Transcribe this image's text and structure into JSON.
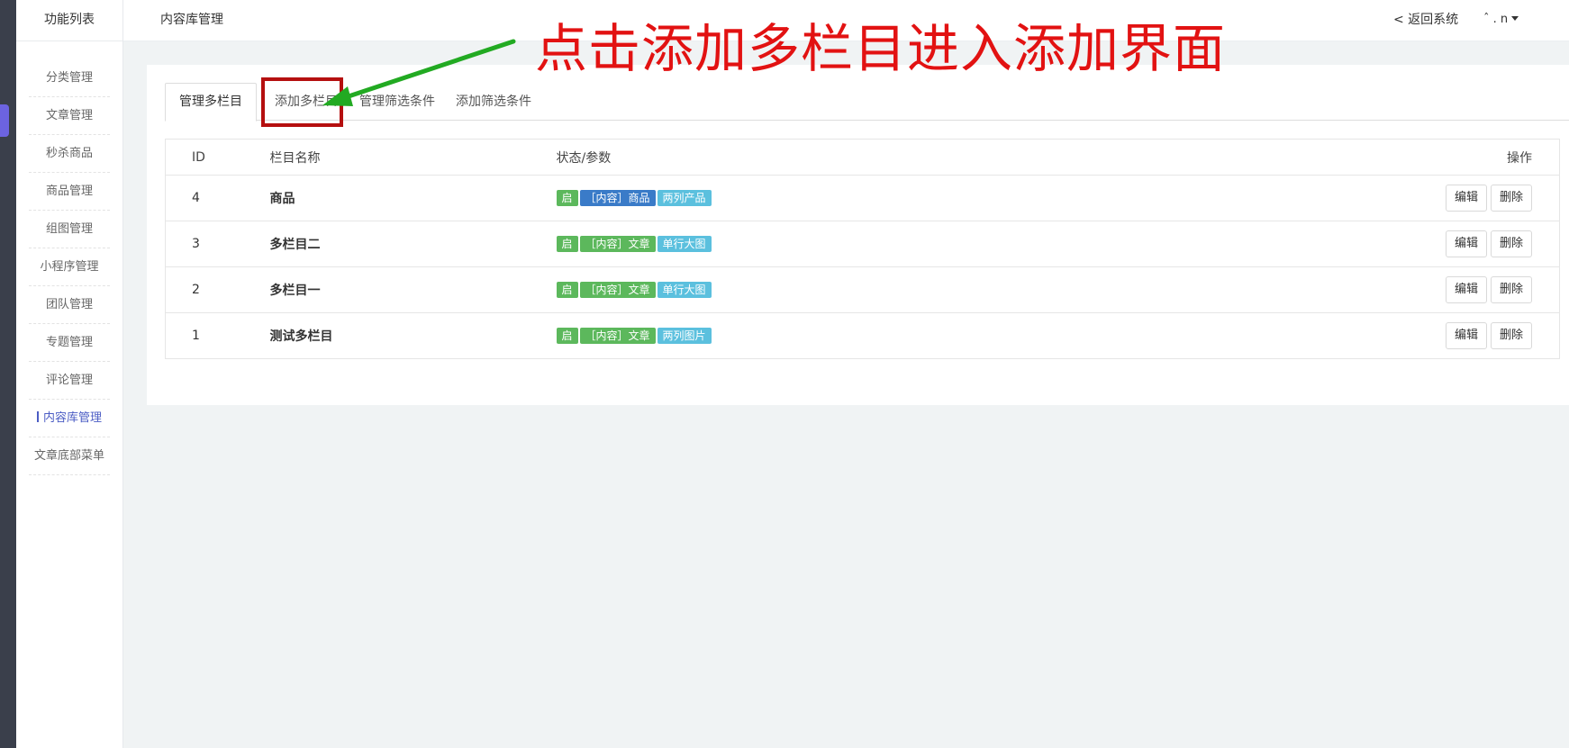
{
  "sidebar": {
    "title": "功能列表",
    "items": [
      "分类管理",
      "文章管理",
      "秒杀商品",
      "商品管理",
      "组图管理",
      "小程序管理",
      "团队管理",
      "专题管理",
      "评论管理",
      "内容库管理",
      "文章底部菜单"
    ],
    "active_index": 9
  },
  "topbar": {
    "page_title": "内容库管理",
    "back_link": "< 返回系统",
    "user_menu": "ˆ . n"
  },
  "annotation": {
    "text": "点击添加多栏目进入添加界面",
    "color": "#e21212",
    "arrow_color": "#22aa22"
  },
  "tabs": [
    "管理多栏目",
    "添加多栏目",
    "管理筛选条件",
    "添加筛选条件"
  ],
  "table": {
    "headers": {
      "id": "ID",
      "name": "栏目名称",
      "status": "状态/参数",
      "ops": "操作"
    },
    "rows": [
      {
        "id": "4",
        "name": "商品",
        "badges": [
          "启",
          "［内容］商品",
          "两列产品"
        ]
      },
      {
        "id": "3",
        "name": "多栏目二",
        "badges": [
          "启",
          "［内容］文章",
          "单行大图"
        ]
      },
      {
        "id": "2",
        "name": "多栏目一",
        "badges": [
          "启",
          "［内容］文章",
          "单行大图"
        ]
      },
      {
        "id": "1",
        "name": "测试多栏目",
        "badges": [
          "启",
          "［内容］文章",
          "两列图片"
        ]
      }
    ],
    "edit_label": "编辑",
    "delete_label": "删除"
  },
  "colors": {
    "badge_green": "#5cb85c",
    "badge_blue": "#3a7bc8",
    "badge_cyan": "#5bc0de",
    "accent": "#4b5cc4"
  }
}
